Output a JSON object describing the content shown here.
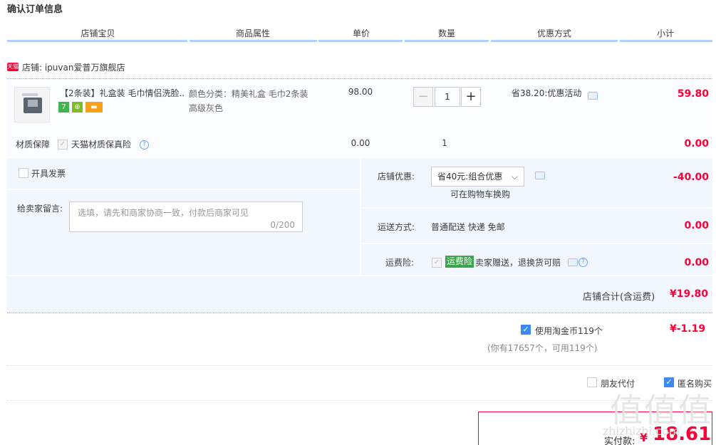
{
  "page_title": "确认订单信息",
  "columns": [
    "店铺宝贝",
    "商品属性",
    "单价",
    "数量",
    "优惠方式",
    "小计"
  ],
  "shop": {
    "badge": "天猫",
    "label": "店铺: ipuvan爱普万旗舰店"
  },
  "item": {
    "title": "【2条装】礼盒装 毛巾情侣洗脸...",
    "tags": [
      {
        "text": "7",
        "color": "#3fb54d"
      },
      {
        "text": "⊕",
        "color": "#7cbd22"
      },
      {
        "text": "▬",
        "color": "#f7a11b"
      }
    ],
    "attr_line1": "颜色分类：精美礼盒 毛巾2条装",
    "attr_line2": "高级灰色",
    "price": "98.00",
    "qty": "1",
    "minus": "−",
    "plus": "+",
    "discount": "省38.20:优惠活动",
    "subtotal": "59.80"
  },
  "material": {
    "label": "材质保障",
    "option": "天猫材质保真险",
    "price": "0.00",
    "qty": "1",
    "subtotal": "0.00"
  },
  "invoice_label": "开具发票",
  "message": {
    "label": "给卖家留言:",
    "placeholder": "选填，请先和商家协商一致，付款后商家可见",
    "counter": "0/200"
  },
  "shop_discount": {
    "label": "店铺优惠:",
    "selected": "省40元:组合优惠",
    "hint": "可在购物车换购",
    "amount": "-40.00"
  },
  "shipping": {
    "label": "运送方式:",
    "value": "普通配送 快递 免邮",
    "amount": "0.00"
  },
  "insurance": {
    "label": "运费险:",
    "badge": "运费险",
    "text": "卖家赠送，退换货可赔",
    "amount": "0.00"
  },
  "shop_total": {
    "label": "店铺合计(含运费)",
    "amount": "¥19.80"
  },
  "coin": {
    "label": "使用淘金币119个",
    "amount": "¥-1.19",
    "note": "(你有17657个，可用119个)"
  },
  "friend_pay": "朋友代付",
  "anonymous": "匿名购买",
  "pay": {
    "label": "实付款:",
    "currency": "¥",
    "amount": "18.61"
  },
  "watermark": {
    "text": "值值值",
    "domain": "zhizhizhi.com"
  },
  "colors": {
    "accent_red": "#ff0036",
    "header_line": "#b2d1ff",
    "section_bg": "#f2f7ff",
    "checkbox_blue": "#3d8af5"
  }
}
